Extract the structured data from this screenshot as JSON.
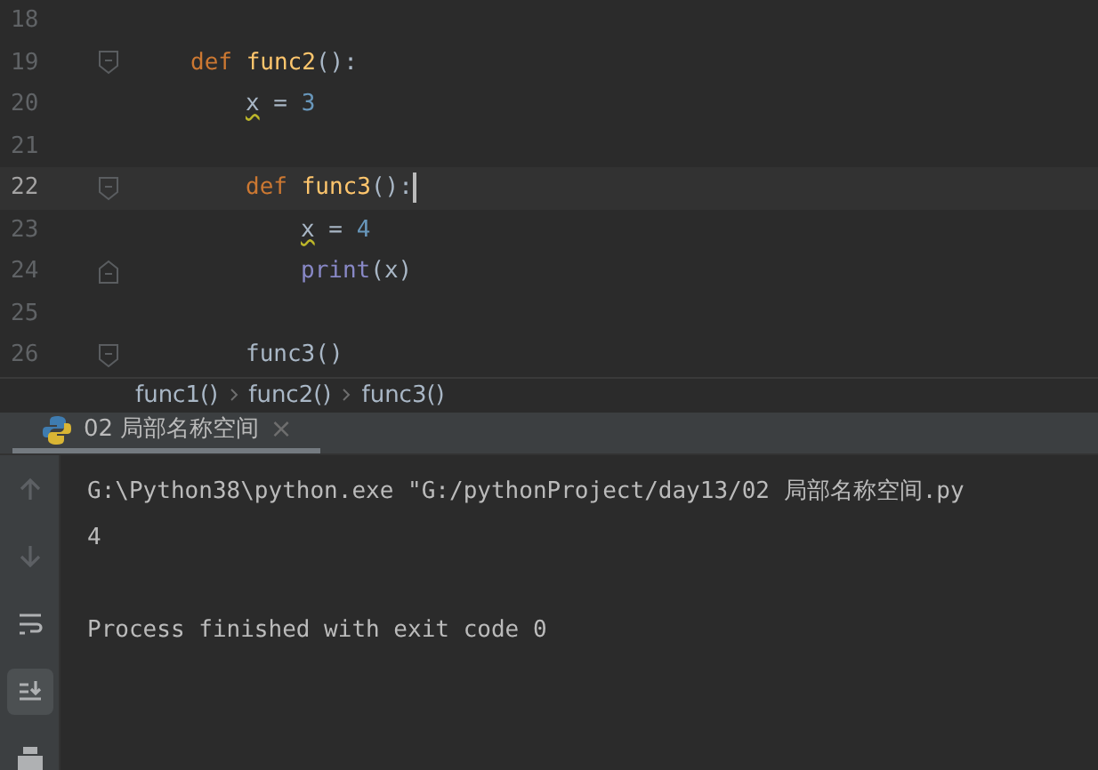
{
  "editor": {
    "lines": [
      {
        "number": "18",
        "current": false
      },
      {
        "number": "19",
        "kind": "fold-start",
        "current": false,
        "tokens": [
          {
            "kind": "keyword",
            "text": "def "
          },
          {
            "kind": "function",
            "text": "func2"
          },
          {
            "kind": "plain",
            "text": "():"
          }
        ],
        "children": [
          {
            "number": "20",
            "current": false,
            "tokens": [
              {
                "kind": "warn",
                "text": "x"
              },
              {
                "kind": "plain",
                "text": " = "
              },
              {
                "kind": "number",
                "text": "3"
              }
            ]
          },
          {
            "number": "21",
            "current": false
          },
          {
            "number": "22",
            "kind": "fold-start",
            "current": true,
            "tokens": [
              {
                "kind": "keyword",
                "text": "def "
              },
              {
                "kind": "function",
                "text": "func3"
              },
              {
                "kind": "plain",
                "text": "():"
              }
            ],
            "children": [
              {
                "number": "23",
                "current": false,
                "tokens": [
                  {
                    "kind": "warn",
                    "text": "x"
                  },
                  {
                    "kind": "plain",
                    "text": " = "
                  },
                  {
                    "kind": "number",
                    "text": "4"
                  }
                ]
              },
              {
                "number": "24",
                "kind": "fold-end",
                "current": false,
                "tokens": [
                  {
                    "kind": "builtin",
                    "text": "print"
                  },
                  {
                    "kind": "plain",
                    "text": "(x)"
                  }
                ]
              }
            ]
          },
          {
            "number": "25",
            "current": false
          },
          {
            "number": "26",
            "kind": "fold-start",
            "current": false,
            "tokens": [
              {
                "kind": "plain",
                "text": "func3()"
              }
            ]
          }
        ]
      }
    ]
  },
  "breadcrumbs": [
    {
      "label": "func1()"
    },
    {
      "label": "func2()"
    },
    {
      "label": "func3()"
    }
  ],
  "run_tab": {
    "title": "02 局部名称空间",
    "selected": true,
    "close": "×"
  },
  "toolbar": [
    {
      "kind": "up",
      "selected": false
    },
    {
      "kind": "down",
      "selected": false
    },
    {
      "kind": "wrap",
      "selected": false
    },
    {
      "kind": "scroll-end",
      "selected": true
    },
    {
      "kind": "print",
      "selected": false
    }
  ],
  "console": [
    {
      "kind": "output",
      "text": "G:\\Python38\\python.exe \"G:/pythonProject/day13/02 局部名称空间.py"
    },
    {
      "kind": "output",
      "text": "4"
    },
    {
      "kind": "exit",
      "text": "Process finished with exit code 0"
    }
  ]
}
